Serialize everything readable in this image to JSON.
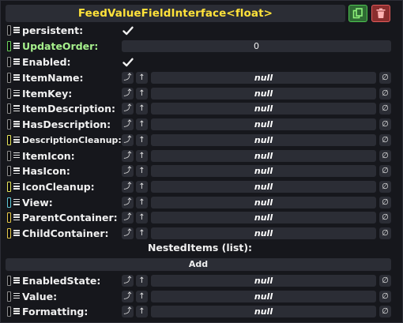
{
  "header": {
    "title": "FeedValueFieldInterface<float>",
    "duplicate_icon": "duplicate-icon",
    "delete_icon": "trash-icon"
  },
  "colors": {
    "title": "#ffe23a",
    "background": "#16171c",
    "field": "#2b2d35",
    "duplicate": "#2f6b34",
    "delete": "#8a2e2e"
  },
  "fields": {
    "persistent": {
      "label": "persistent:",
      "checked": true
    },
    "update_order": {
      "label": "UpdateOrder:",
      "value": "0"
    },
    "enabled": {
      "label": "Enabled:",
      "checked": true
    }
  },
  "ref_buttons": {
    "reset": "⤴",
    "up": "↑",
    "clear": "∅"
  },
  "ref_fields": [
    {
      "label": "ItemName:",
      "value": "null",
      "connector": "#8c8c8c"
    },
    {
      "label": "ItemKey:",
      "value": "null",
      "connector": "#8c8c8c"
    },
    {
      "label": "ItemDescription:",
      "value": "null",
      "connector": "#8c8c8c"
    },
    {
      "label": "HasDescription:",
      "value": "null",
      "connector": "#8c8c8c"
    },
    {
      "label": "DescriptionCleanup:",
      "value": "null",
      "connector": "#e6e45a"
    },
    {
      "label": "ItemIcon:",
      "value": "null",
      "connector": "#8c8c8c"
    },
    {
      "label": "HasIcon:",
      "value": "null",
      "connector": "#8c8c8c"
    },
    {
      "label": "IconCleanup:",
      "value": "null",
      "connector": "#e6e45a"
    },
    {
      "label": "View:",
      "value": "null",
      "connector": "#5fc6d6"
    },
    {
      "label": "ParentContainer:",
      "value": "null",
      "connector": "#e6c84a"
    },
    {
      "label": "ChildContainer:",
      "value": "null",
      "connector": "#e6c84a"
    }
  ],
  "nested": {
    "title": "NestedItems (list):",
    "add_label": "Add"
  },
  "ref_fields_2": [
    {
      "label": "EnabledState:",
      "value": "null",
      "connector": "#8c8c8c"
    },
    {
      "label": "Value:",
      "value": "null",
      "connector": "#8c8c8c"
    },
    {
      "label": "Formatting:",
      "value": "null",
      "connector": "#8c8c8c"
    }
  ]
}
